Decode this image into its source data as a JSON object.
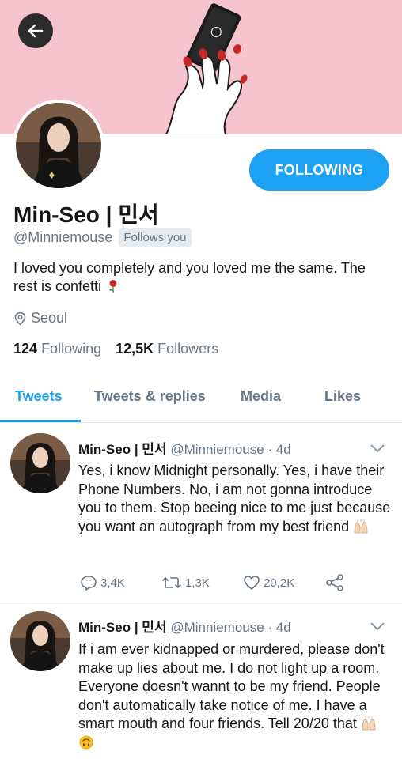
{
  "header": {
    "back_icon": "arrow-left-icon"
  },
  "profile": {
    "name": "Min-Seo | 민서",
    "handle": "@Minniemouse",
    "follows_you": "Follows you",
    "bio": "I loved you completely and you loved me the same. The rest is confetti",
    "bio_emoji": "rose",
    "location": "Seoul",
    "following_count": "124",
    "following_label": "Following",
    "followers_count": "12,5K",
    "followers_label": "Followers",
    "follow_button": "FOLLOWING"
  },
  "tabs": [
    {
      "label": "Tweets",
      "active": true
    },
    {
      "label": "Tweets & replies",
      "active": false
    },
    {
      "label": "Media",
      "active": false
    },
    {
      "label": "Likes",
      "active": false
    }
  ],
  "tweets": [
    {
      "name": "Min-Seo | 민서",
      "meta": "@Minniemouse · 4d",
      "text": "Yes, i know Midnight personally. Yes, i have their Phone Numbers. No, i am not gonna introduce you to them. Stop beeing nice to me just because you want an autograph from my best friend",
      "emoji": [
        "raising-hands"
      ],
      "replies": "3,4K",
      "retweets": "1,3K",
      "likes": "20,2K"
    },
    {
      "name": "Min-Seo | 민서",
      "meta": "@Minniemouse · 4d",
      "text": "If i am ever kidnapped or murdered, please don't make up lies about me. I do not light up a room. Everyone doesn't wannt to be my friend. People don't automatically take notice of me. I have a smart mouth and four friends. Tell 20/20 that",
      "emoji": [
        "raising-hands",
        "upside-down-face"
      ]
    }
  ],
  "colors": {
    "accent": "#1da1f2",
    "banner": "#f6c4cf",
    "muted": "#657786",
    "text": "#14171a"
  }
}
